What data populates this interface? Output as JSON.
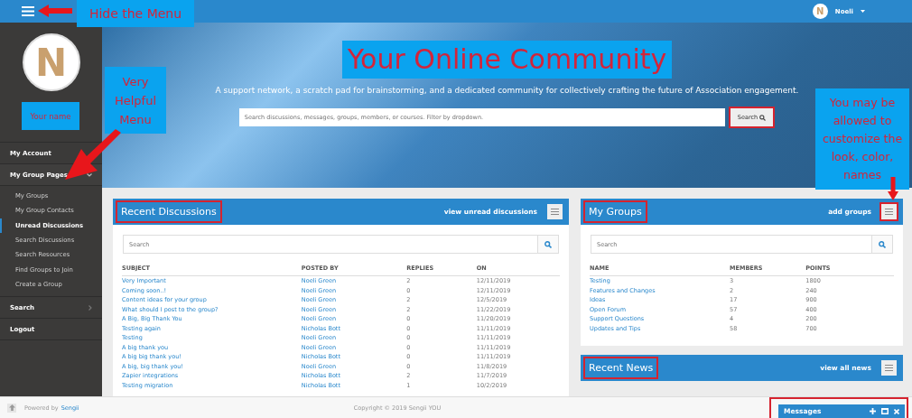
{
  "topbar": {
    "user": {
      "initial": "N",
      "name": "Noeli"
    }
  },
  "sidebar": {
    "avatar_initial": "N",
    "items": [
      {
        "label": "My Account"
      },
      {
        "label": "My Group Pages",
        "expanded": true,
        "children": [
          {
            "label": "My Groups",
            "selected": false
          },
          {
            "label": "My Group Contacts",
            "selected": false
          },
          {
            "label": "Unread Discussions",
            "selected": true
          },
          {
            "label": "Search Discussions",
            "selected": false
          },
          {
            "label": "Search Resources",
            "selected": false
          },
          {
            "label": "Find Groups to Join",
            "selected": false
          },
          {
            "label": "Create a Group",
            "selected": false
          }
        ]
      },
      {
        "label": "Search",
        "expanded": false
      },
      {
        "label": "Logout"
      }
    ]
  },
  "hero": {
    "title": "Your Online Community",
    "subtitle": "A support network, a scratch pad for brainstorming, and a dedicated community for collectively crafting the future of Association engagement.",
    "search": {
      "placeholder": "Search discussions, messages, groups, members, or courses. Filter by dropdown.",
      "button": "Search",
      "highlighted": true
    }
  },
  "recent_discussions": {
    "title": "Recent Discussions",
    "highlighted": true,
    "link": "view unread discussions",
    "menu_highlighted": false,
    "search": {
      "placeholder": "Search"
    },
    "columns": [
      "SUBJECT",
      "POSTED BY",
      "REPLIES",
      "ON"
    ],
    "rows": [
      [
        "Very Important",
        "Noeli Green",
        "2",
        "12/11/2019"
      ],
      [
        "Coming soon..!",
        "Noeli Green",
        "0",
        "12/11/2019"
      ],
      [
        "Content ideas for your group",
        "Noeli Green",
        "2",
        "12/5/2019"
      ],
      [
        "What should I post to the group?",
        "Noeli Green",
        "2",
        "11/22/2019"
      ],
      [
        "A Big, Big Thank You",
        "Noeli Green",
        "0",
        "11/20/2019"
      ],
      [
        "Testing again",
        "Nicholas Bott",
        "0",
        "11/11/2019"
      ],
      [
        "Testing",
        "Noeli Green",
        "0",
        "11/11/2019"
      ],
      [
        "A big thank you",
        "Noeli Green",
        "0",
        "11/11/2019"
      ],
      [
        "A big big thank you!",
        "Nicholas Bott",
        "0",
        "11/11/2019"
      ],
      [
        "A big, big thank you!",
        "Noeli Green",
        "0",
        "11/8/2019"
      ],
      [
        "Zapier integrations",
        "Nicholas Bott",
        "2",
        "11/7/2019"
      ],
      [
        "Testing migration",
        "Nicholas Bott",
        "1",
        "10/2/2019"
      ]
    ]
  },
  "my_groups": {
    "title": "My Groups",
    "highlighted": true,
    "link": "add groups",
    "menu_highlighted": true,
    "search": {
      "placeholder": "Search"
    },
    "columns": [
      "NAME",
      "MEMBERS",
      "POINTS"
    ],
    "rows": [
      [
        "Testing",
        "3",
        "1800"
      ],
      [
        "Features and Changes",
        "2",
        "240"
      ],
      [
        "Ideas",
        "17",
        "900"
      ],
      [
        "Open Forum",
        "57",
        "400"
      ],
      [
        "Support Questions",
        "4",
        "200"
      ],
      [
        "Updates and Tips",
        "58",
        "700"
      ]
    ]
  },
  "recent_news": {
    "title": "Recent News",
    "highlighted": true,
    "link": "view all news",
    "menu_highlighted": false
  },
  "footer": {
    "powered_by": "Powered by",
    "brand": "Sengii",
    "copyright": "Copyright © 2019 Sengii YOU"
  },
  "messages": {
    "title": "Messages",
    "highlighted": true
  },
  "annotations": [
    {
      "kind": "hide-menu",
      "text": "Hide the Menu"
    },
    {
      "kind": "your-name",
      "text": "Your name"
    },
    {
      "kind": "helpful-menu",
      "text": "Very Helpful Menu"
    },
    {
      "kind": "customize",
      "text": "You may be allowed to customize the look, color, names"
    }
  ]
}
